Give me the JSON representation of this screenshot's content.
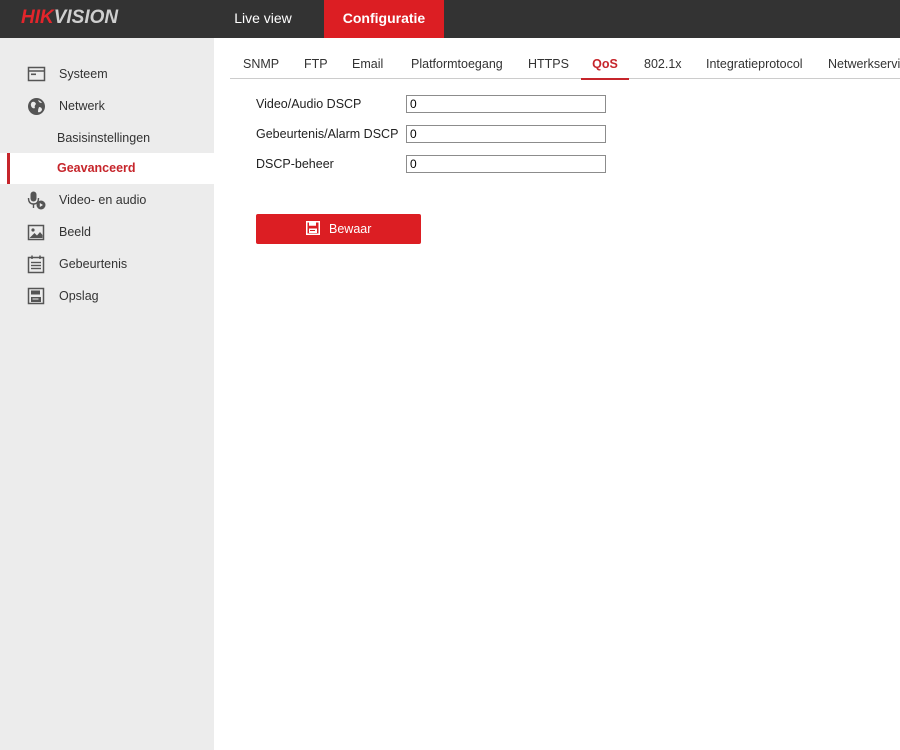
{
  "header": {
    "logo_part1": "HIK",
    "logo_part2": "VISION",
    "nav": {
      "live_view": "Live view",
      "configuratie": "Configuratie"
    }
  },
  "sidebar": {
    "items": [
      {
        "label": "Systeem",
        "icon": "monitor-icon"
      },
      {
        "label": "Netwerk",
        "icon": "globe-icon"
      },
      {
        "label": "Basisinstellingen"
      },
      {
        "label": "Geavanceerd",
        "active": true
      },
      {
        "label": "Video- en audio",
        "icon": "microphone-icon"
      },
      {
        "label": "Beeld",
        "icon": "image-icon"
      },
      {
        "label": "Gebeurtenis",
        "icon": "calendar-icon"
      },
      {
        "label": "Opslag",
        "icon": "storage-icon"
      }
    ]
  },
  "tabs": {
    "items": [
      "SNMP",
      "FTP",
      "Email",
      "Platformtoegang",
      "HTTPS",
      "QoS",
      "802.1x",
      "Integratieprotocol",
      "Netwerkservi"
    ],
    "active": "QoS"
  },
  "form": {
    "video_audio_dscp": {
      "label": "Video/Audio DSCP",
      "value": "0"
    },
    "event_alarm_dscp": {
      "label": "Gebeurtenis/Alarm DSCP",
      "value": "0"
    },
    "dscp_beheer": {
      "label": "DSCP-beheer",
      "value": "0"
    }
  },
  "actions": {
    "save_label": "Bewaar",
    "save_icon": "save-icon"
  },
  "colors": {
    "accent": "#dc1e23",
    "topbar": "#333333",
    "sidebar": "#ececec"
  }
}
